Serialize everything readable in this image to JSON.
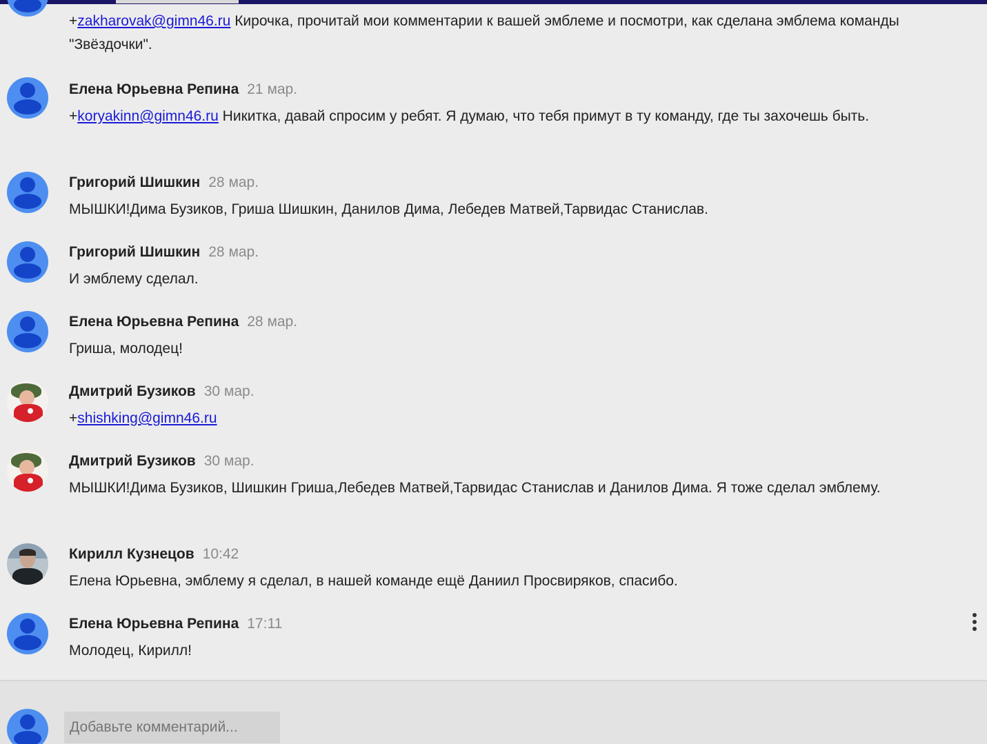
{
  "comments": [
    {
      "author": "",
      "time": "",
      "prefix": "+",
      "mention": "zakharovak@gimn46.ru",
      "text": " Кирочка, прочитай мои комментарии к вашей эмблеме и посмотри, как сделана эмблема команды \"Звёздочки\"."
    },
    {
      "author": "Елена Юрьевна Репина",
      "time": "21 мар.",
      "prefix": "+",
      "mention": "koryakinn@gimn46.ru",
      "text": " Никитка, давай спросим у ребят. Я думаю, что тебя примут в ту команду, где ты захочешь быть."
    },
    {
      "author": "Григорий Шишкин",
      "time": "28 мар.",
      "text": "МЫШКИ!Дима Бузиков, Гриша Шишкин, Данилов Дима, Лебедев Матвей,Тарвидас Станислав."
    },
    {
      "author": "Григорий Шишкин",
      "time": "28 мар.",
      "text": "И эмблему сделал."
    },
    {
      "author": "Елена Юрьевна Репина",
      "time": "28 мар.",
      "text": "Гриша, молодец!"
    },
    {
      "author": "Дмитрий Бузиков",
      "time": "30 мар.",
      "prefix": "+",
      "mention": "shishking@gimn46.ru",
      "text": ""
    },
    {
      "author": "Дмитрий Бузиков",
      "time": "30 мар.",
      "text": "МЫШКИ!Дима Бузиков, Шишкин Гриша,Лебедев Матвей,Тарвидас Станислав и Данилов Дима. Я тоже сделал эмблему."
    },
    {
      "author": "Кирилл Кузнецов",
      "time": "10:42",
      "text": "Елена Юрьевна, эмблему я сделал, в нашей команде ещё Даниил Просвиряков, спасибо."
    },
    {
      "author": "Елена Юрьевна Репина",
      "time": "17:11",
      "text": "Молодец, Кирилл!"
    }
  ],
  "composer": {
    "placeholder": "Добавьте комментарий..."
  },
  "colors": {
    "accent_bar": "#1a1464",
    "link": "#1a1ad8",
    "default_avatar": "#4d8ef0"
  },
  "icons": [
    "user-avatar-icon",
    "more-vert-icon"
  ]
}
